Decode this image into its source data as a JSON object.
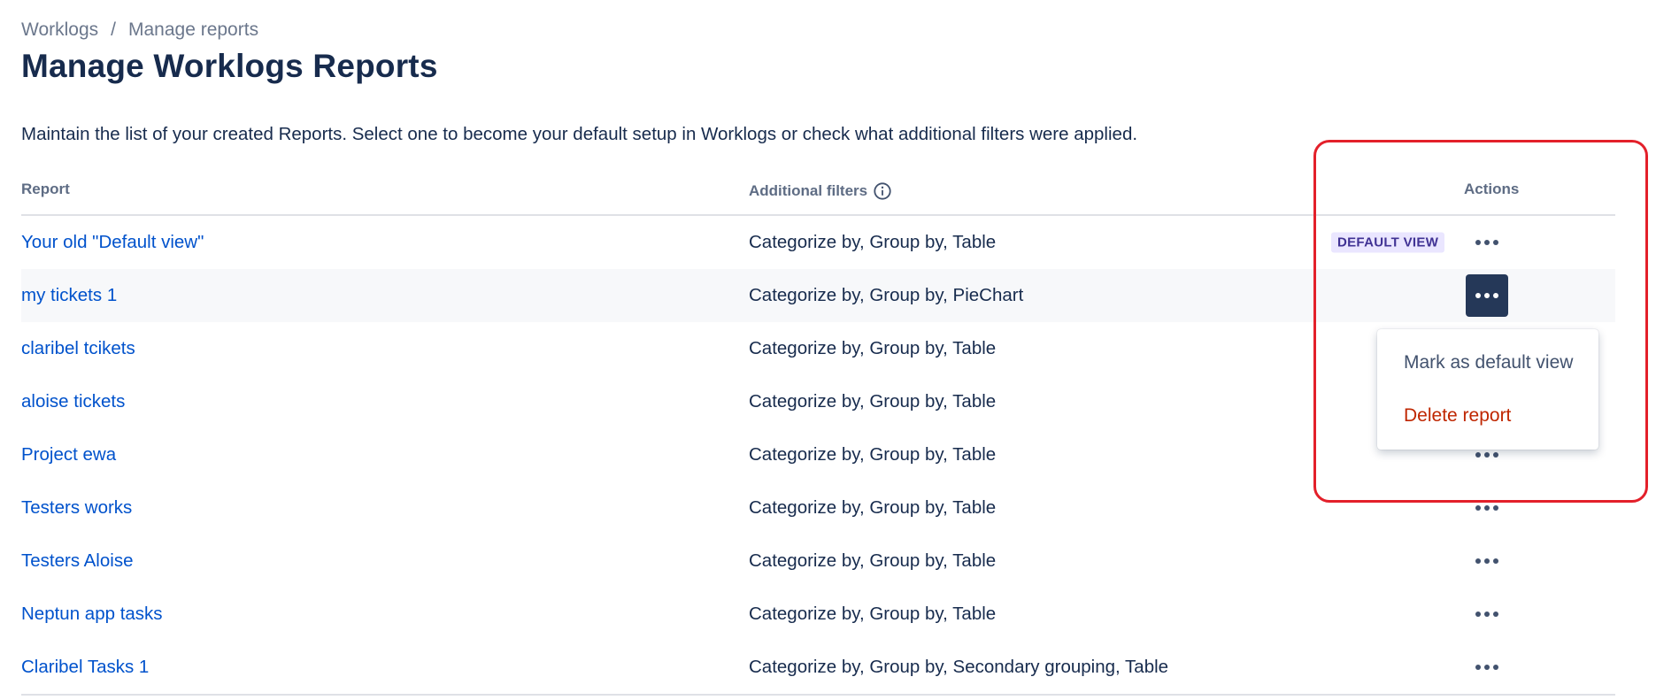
{
  "breadcrumb": {
    "items": [
      "Worklogs",
      "Manage reports"
    ],
    "separator": "/"
  },
  "page": {
    "title": "Manage Worklogs Reports",
    "description": "Maintain the list of your created Reports. Select one to become your default setup in Worklogs or check what additional filters were applied."
  },
  "table": {
    "headers": {
      "report": "Report",
      "filters": "Additional filters",
      "actions": "Actions"
    },
    "rows": [
      {
        "name": "Your old \"Default view\"",
        "filters": "Categorize by, Group by, Table",
        "badge": "DEFAULT VIEW"
      },
      {
        "name": "my tickets 1",
        "filters": "Categorize by, Group by, PieChart"
      },
      {
        "name": "claribel tcikets",
        "filters": "Categorize by, Group by, Table"
      },
      {
        "name": "aloise tickets",
        "filters": "Categorize by, Group by, Table"
      },
      {
        "name": "Project ewa",
        "filters": "Categorize by, Group by, Table"
      },
      {
        "name": "Testers works",
        "filters": "Categorize by, Group by, Table"
      },
      {
        "name": "Testers Aloise",
        "filters": "Categorize by, Group by, Table"
      },
      {
        "name": "Neptun app tasks",
        "filters": "Categorize by, Group by, Table"
      },
      {
        "name": "Claribel Tasks 1",
        "filters": "Categorize by, Group by, Secondary grouping, Table"
      }
    ]
  },
  "dropdown": {
    "items": [
      "Mark as default view",
      "Delete report"
    ]
  },
  "icons": {
    "info": "info-icon",
    "more": "more-horizontal-icon"
  },
  "colors": {
    "link": "#0052cc",
    "danger": "#bf2600",
    "badge_bg": "#eae6ff",
    "badge_text": "#403294",
    "active_button": "#253858",
    "annotation": "#e3202a"
  }
}
